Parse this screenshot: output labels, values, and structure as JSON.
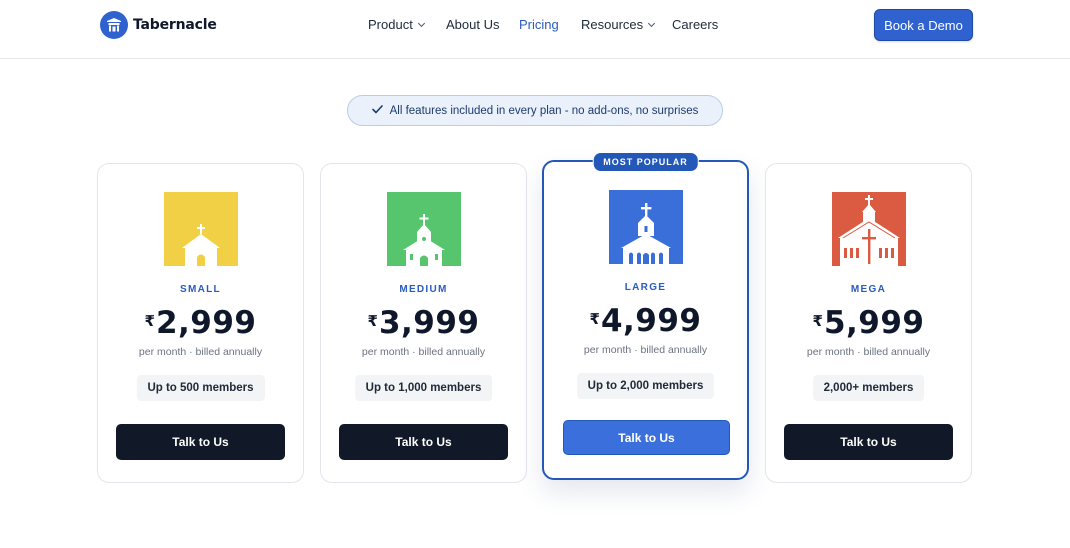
{
  "header": {
    "brand_name": "Tabernacle",
    "nav": [
      {
        "label": "Product",
        "has_dropdown": true,
        "active": false
      },
      {
        "label": "About Us",
        "has_dropdown": false,
        "active": false
      },
      {
        "label": "Pricing",
        "has_dropdown": false,
        "active": true
      },
      {
        "label": "Resources",
        "has_dropdown": true,
        "active": false
      },
      {
        "label": "Careers",
        "has_dropdown": false,
        "active": false
      }
    ],
    "cta_label": "Book a Demo"
  },
  "banner": {
    "icon": "check-icon",
    "text": "All features included in every plan - no add-ons, no surprises"
  },
  "plans": [
    {
      "tier": "SMALL",
      "currency": "₹",
      "price": "2,999",
      "billing": "per month · billed annually",
      "members": "Up to 500 members",
      "cta": "Talk to Us",
      "icon": "small-church-icon",
      "icon_bg": "#f2d046",
      "popular": false
    },
    {
      "tier": "MEDIUM",
      "currency": "₹",
      "price": "3,999",
      "billing": "per month · billed annually",
      "members": "Up to 1,000 members",
      "cta": "Talk to Us",
      "icon": "medium-church-icon",
      "icon_bg": "#57c46e",
      "popular": false
    },
    {
      "tier": "LARGE",
      "currency": "₹",
      "price": "4,999",
      "billing": "per month · billed annually",
      "members": "Up to 2,000 members",
      "cta": "Talk to Us",
      "icon": "large-church-icon",
      "icon_bg": "#3a6ed8",
      "popular": true,
      "badge": "MOST POPULAR"
    },
    {
      "tier": "MEGA",
      "currency": "₹",
      "price": "5,999",
      "billing": "per month · billed annually",
      "members": "2,000+ members",
      "cta": "Talk to Us",
      "icon": "mega-church-icon",
      "icon_bg": "#db5a42",
      "popular": false
    }
  ],
  "colors": {
    "brand_blue": "#2f62cf",
    "accent_text": "#2a5bbd",
    "dark_button": "#111827"
  }
}
